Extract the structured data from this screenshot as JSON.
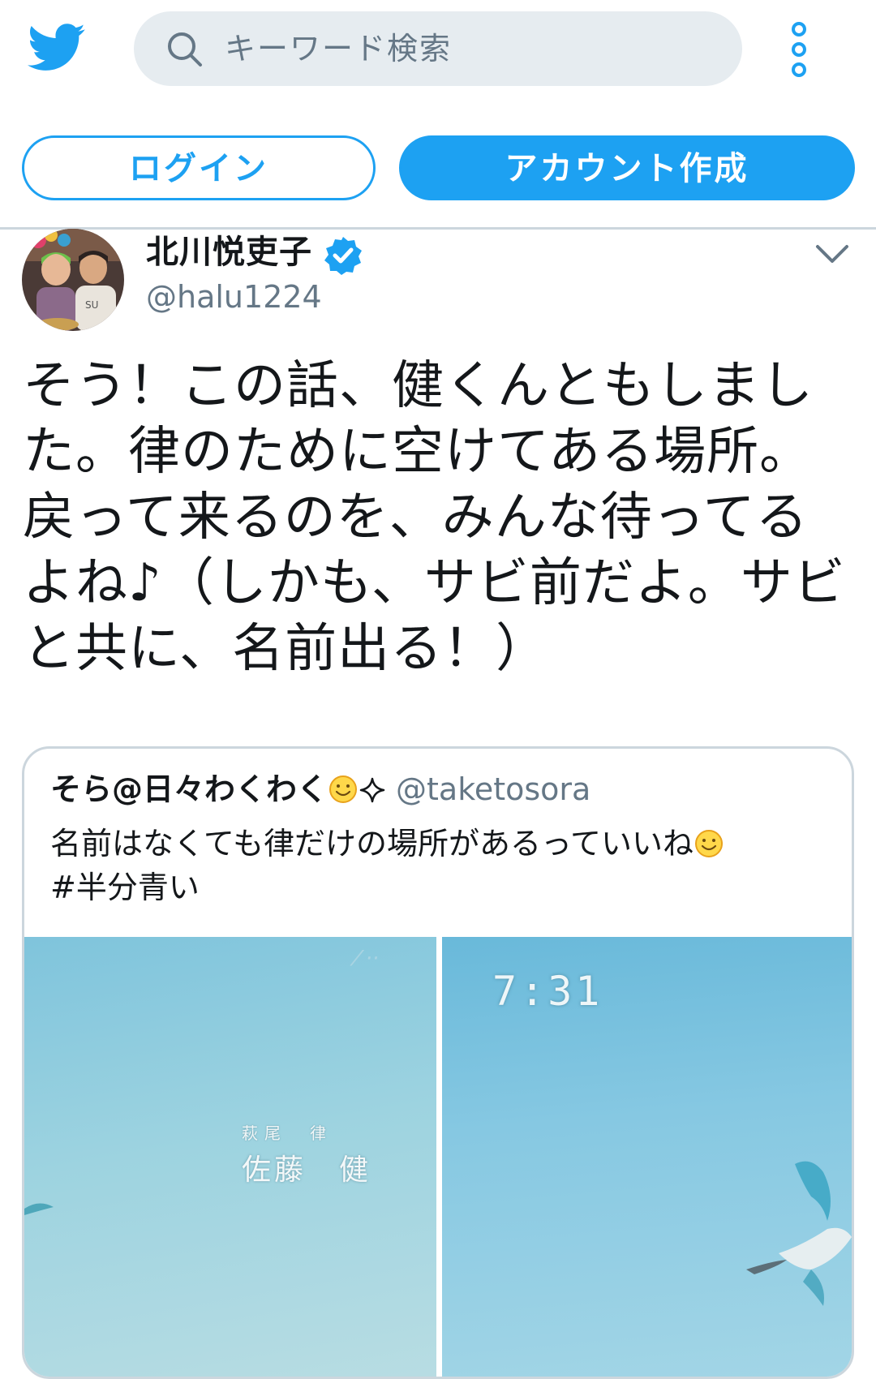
{
  "colors": {
    "accent": "#1da1f2",
    "search_bg": "#e6ecf0",
    "secondary_text": "#657786",
    "divider": "#ccd6dd"
  },
  "topbar": {
    "logo_icon": "twitter-bird-icon",
    "search": {
      "placeholder": "キーワード検索",
      "icon": "search-icon"
    },
    "more_icon": "more-vertical-icon"
  },
  "auth": {
    "login_label": "ログイン",
    "signup_label": "アカウント作成"
  },
  "tweet": {
    "display_name": "北川悦吏子",
    "verified": true,
    "handle": "@halu1224",
    "text": "そう！この話、健くんともしました。律のために空けてある場所。戻って来るのを、みんな待ってるよね♪（しかも、サビ前だよ。サビと共に、名前出る！）",
    "caret_icon": "chevron-down-icon",
    "quoted": {
      "display_name": "そら@日々わくわく",
      "handle": "@taketosora",
      "text_line1": "名前はなくても律だけの場所があるっていいね",
      "text_line2": "#半分青い",
      "photos": {
        "left": {
          "credit_role": "萩尾　律",
          "credit_name": "佐藤　健"
        },
        "right": {
          "clock": "7:31"
        }
      }
    }
  }
}
